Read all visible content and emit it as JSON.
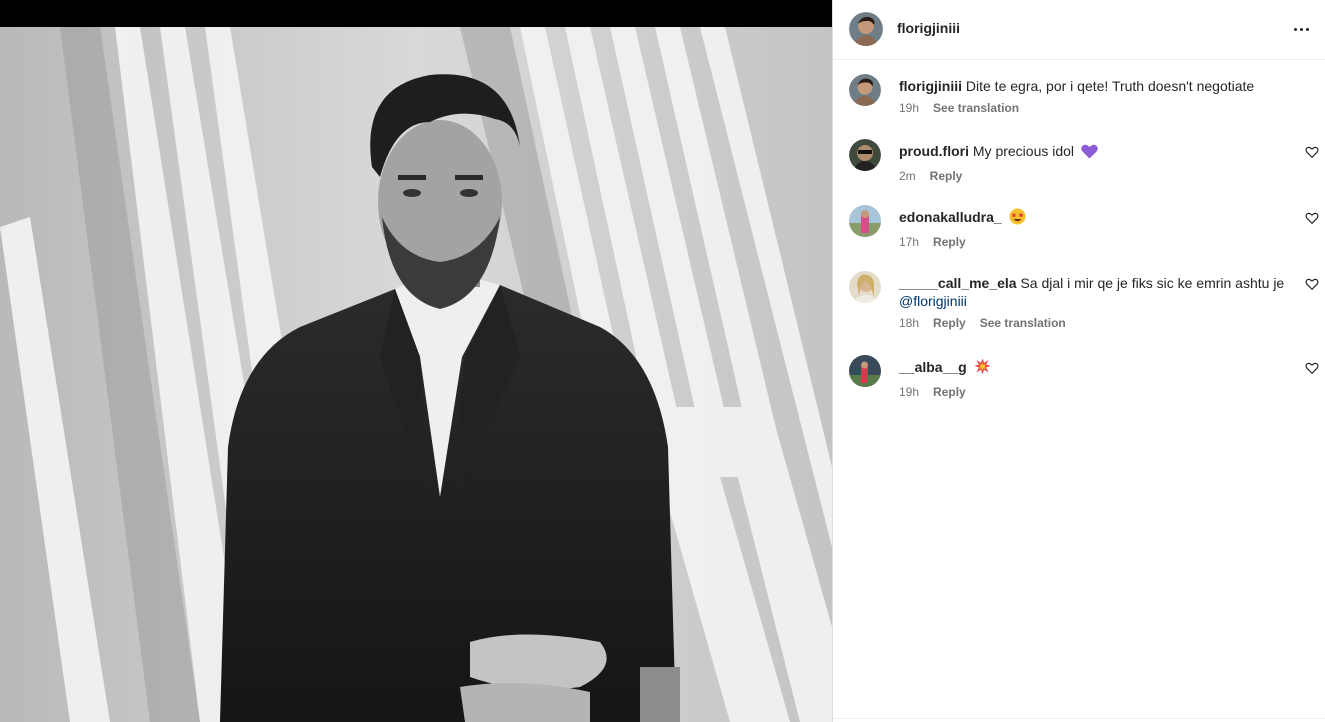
{
  "post": {
    "author": "florigjiniii"
  },
  "caption": {
    "username": "florigjiniii",
    "text": "Dite te egra, por i qete! Truth doesn't negotiate",
    "time": "19h",
    "see_translation": "See translation"
  },
  "comments": [
    {
      "username": "proud.flori",
      "text": "My precious idol",
      "emoji": "purple-heart",
      "time": "2m",
      "reply": "Reply"
    },
    {
      "username": "edonakalludra_",
      "text": "",
      "emoji": "star-struck",
      "time": "17h",
      "reply": "Reply"
    },
    {
      "username": "_____call_me_ela",
      "text": "Sa djal i mir qe je fiks sic ke emrin ashtu je",
      "mention": "@florigjiniii",
      "time": "18h",
      "reply": "Reply",
      "see_translation": "See translation"
    },
    {
      "username": "__alba__g",
      "text": "",
      "emoji": "collision",
      "time": "19h",
      "reply": "Reply"
    }
  ],
  "icons": {
    "more": "more-horizontal-icon",
    "like": "heart-outline-icon"
  },
  "colors": {
    "text": "#262626",
    "secondary": "#737373",
    "mention": "#00376b",
    "emoji_purple": "#8a5cd6"
  }
}
